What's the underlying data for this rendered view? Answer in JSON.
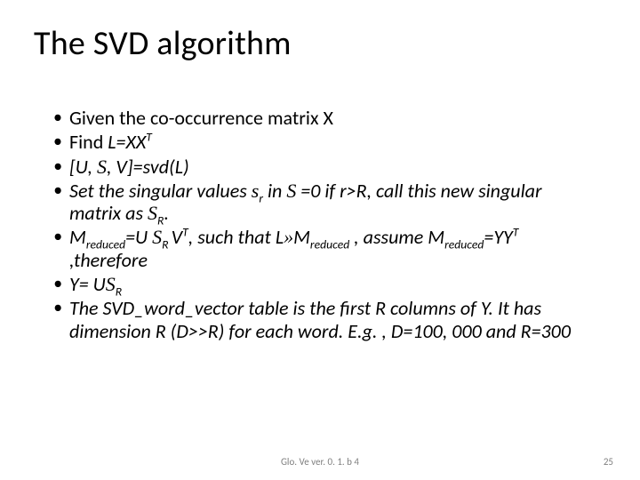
{
  "title": "The SVD algorithm",
  "b1_a": "Given the co-occurrence matrix X",
  "b2_a": "Find ",
  "b2_b": "L=XX",
  "b2_sup": "T",
  "b3_a": "[U, ",
  "b3_b": ", V]=svd(L)",
  "b4_a": "Set the singular values ",
  "b4_sigma_l": "s",
  "b4_sub_r": "r",
  "b4_b": " in ",
  "b4_c": " =0 if r>R, call this new singular matrix as ",
  "b4_sub_R": "R",
  "b4_d": ".",
  "b5_a": "M",
  "b5_sub_red": "reduced",
  "b5_b": "=U ",
  "b5_sub_R": "R ",
  "b5_c": "V",
  "b5_sup_T": "T",
  "b5_d": ", such that L",
  "b5_e": "M",
  "b5_f": " , assume M",
  "b5_g": "=YY",
  "b5_h": " ,therefore",
  "b6_a": "Y= U",
  "b6_sub_R": "R",
  "b7_a": "The SVD_word_vector table is the first R columns of Y. It has dimension R (D>>R) for each word. E.g. , D=100, 000 and R=300",
  "Sigma": "S",
  "approx": "»",
  "footer_center": "Glo. Ve ver. 0. 1. b 4",
  "footer_right": "25"
}
